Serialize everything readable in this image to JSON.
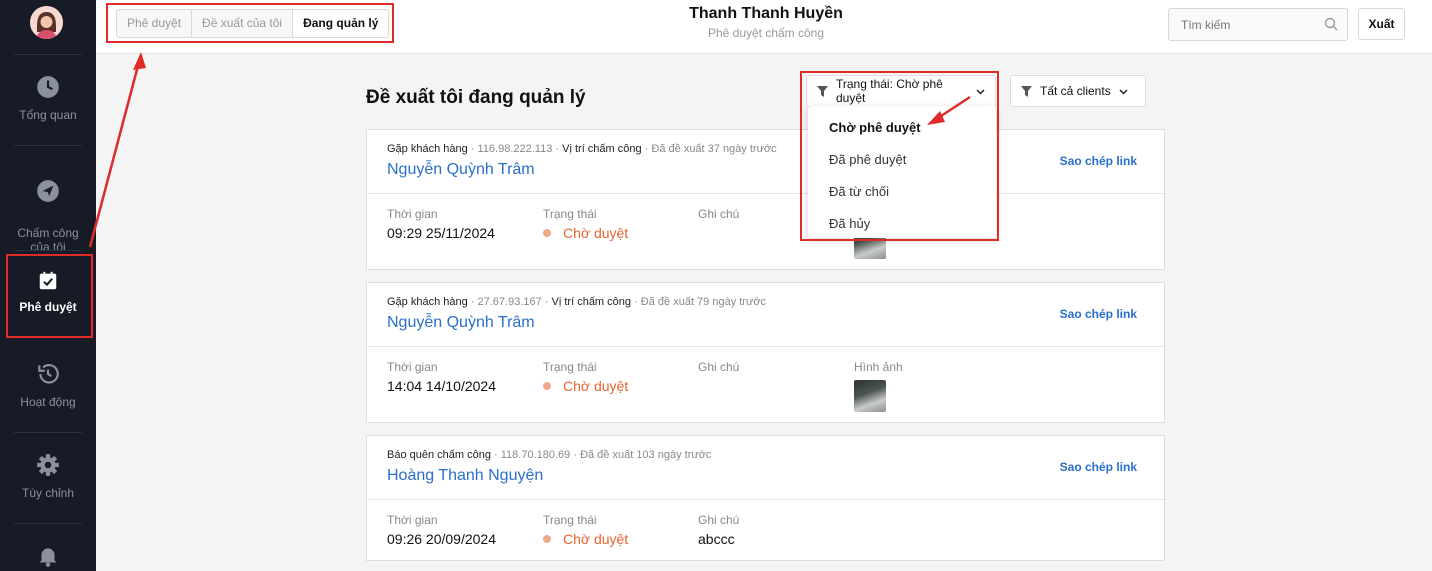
{
  "sidebar": {
    "items": [
      {
        "label": "Tổng quan",
        "icon": "clock-icon"
      },
      {
        "label": "Chấm công\ncủa tôi",
        "icon": "send-icon"
      },
      {
        "label": "Phê duyệt",
        "icon": "check-square-icon"
      },
      {
        "label": "Hoạt động",
        "icon": "history-icon"
      },
      {
        "label": "Tùy chỉnh",
        "icon": "gear-icon"
      }
    ]
  },
  "header": {
    "tabs": [
      "Phê duyệt",
      "Đề xuất của tôi",
      "Đang quản lý"
    ],
    "active_tab": "Đang quản lý",
    "title": "Thanh Thanh Huyền",
    "subtitle": "Phê duyệt chấm công",
    "search_placeholder": "Tìm kiếm",
    "export_label": "Xuất"
  },
  "main": {
    "title": "Đề xuất tôi đang quản lý",
    "status_filter": "Trạng thái: Chờ phê duyệt",
    "client_filter": "Tất cả clients",
    "dropdown_options": [
      "Chờ phê duyệt",
      "Đã phê duyệt",
      "Đã từ chối",
      "Đã hủy"
    ],
    "labels": {
      "time": "Thời gian",
      "status": "Trạng thái",
      "note": "Ghi chú",
      "image": "Hình ảnh",
      "copy": "Sao chép link"
    },
    "cards": [
      {
        "type": "Gặp khách hàng",
        "ip": "116.98.222.113",
        "location": "Vị trí chấm công",
        "ago": "Đã đề xuất 37 ngày trước",
        "name": "Nguyễn Quỳnh Trâm",
        "time": "09:29 25/11/2024",
        "status": "Chờ duyệt",
        "note": ""
      },
      {
        "type": "Gặp khách hàng",
        "ip": "27.67.93.167",
        "location": "Vị trí chấm công",
        "ago": "Đã đề xuất 79 ngày trước",
        "name": "Nguyễn Quỳnh Trâm",
        "time": "14:04 14/10/2024",
        "status": "Chờ duyệt",
        "note": ""
      },
      {
        "type": "Báo quên chấm công",
        "ip": "118.70.180.69",
        "ago": "Đã đề xuất 103 ngày trước",
        "name": "Hoàng Thanh Nguyện",
        "time": "09:26 20/09/2024",
        "status": "Chờ duyệt",
        "note": "abccc"
      }
    ]
  },
  "colors": {
    "sidebar_bg": "#161b26",
    "link": "#2a6fc9",
    "pending": "#e8632c",
    "highlight": "#e02b2b"
  }
}
